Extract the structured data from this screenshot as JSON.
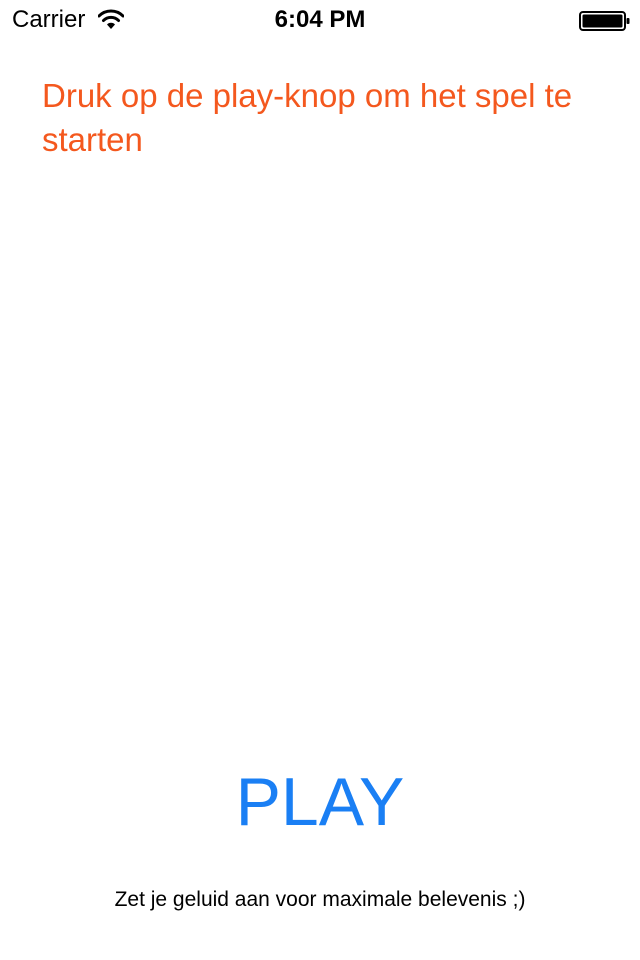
{
  "status_bar": {
    "carrier": "Carrier",
    "time": "6:04 PM",
    "wifi_icon": "wifi-icon",
    "battery_icon": "battery-full-icon",
    "battery_level": 1.0
  },
  "main": {
    "instruction": "Druk op de play-knop om het spel te starten",
    "play_label": "PLAY",
    "sound_hint": "Zet je geluid aan voor maximale belevenis ;)"
  },
  "colors": {
    "instruction": "#f4581e",
    "play": "#1a7ff4",
    "background": "#ffffff"
  }
}
